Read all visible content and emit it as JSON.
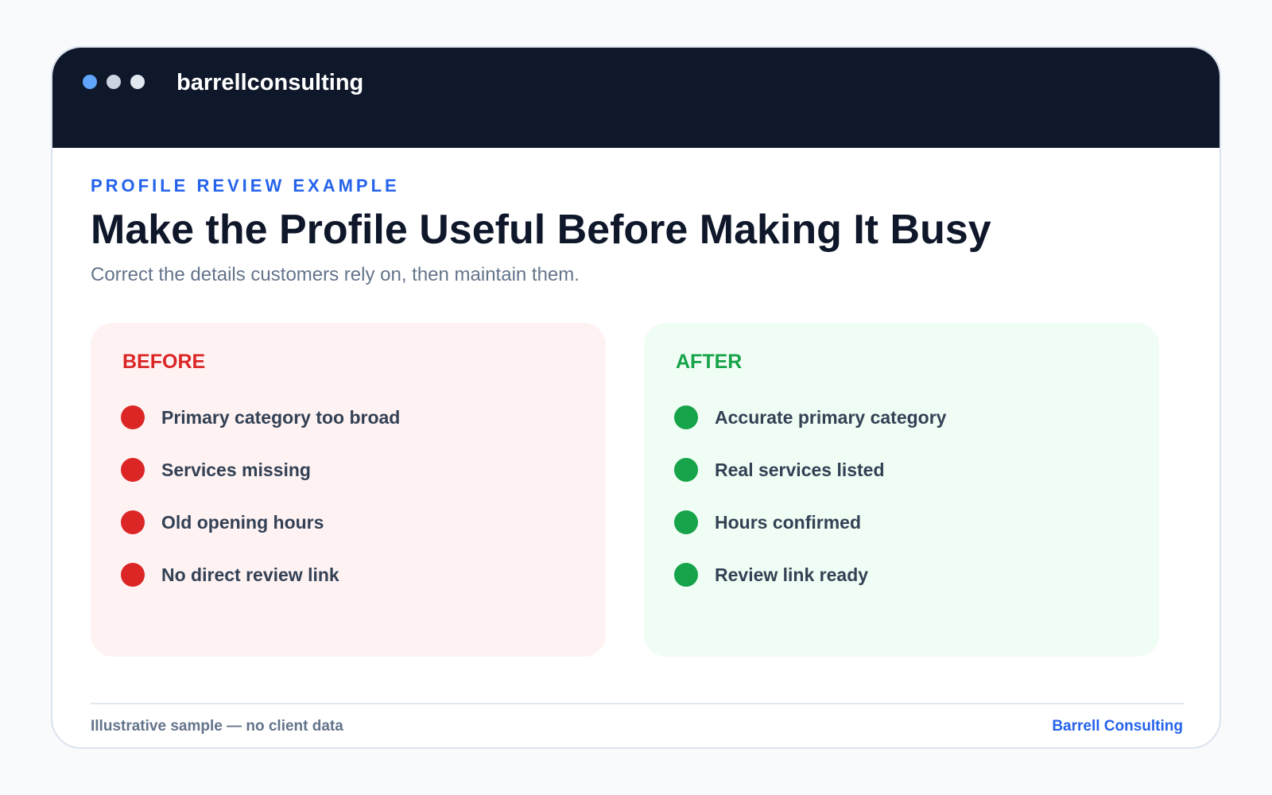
{
  "window": {
    "title": "barrellconsulting",
    "dot_colors": [
      "#60a5fa",
      "#cbd5e1",
      "#e2e8f0"
    ]
  },
  "header": {
    "eyebrow": "PROFILE REVIEW EXAMPLE",
    "title": "Make the Profile Useful Before Making It Busy",
    "subtitle": "Correct the details customers rely on, then maintain them."
  },
  "before": {
    "heading": "BEFORE",
    "color": "#dc2626",
    "items": [
      "Primary category too broad",
      "Services missing",
      "Old opening hours",
      "No direct review link"
    ]
  },
  "after": {
    "heading": "AFTER",
    "color": "#16a34a",
    "items": [
      "Accurate primary category",
      "Real services listed",
      "Hours confirmed",
      "Review link ready"
    ]
  },
  "footer": {
    "note": "Illustrative sample — no client data",
    "brand": "Barrell Consulting"
  },
  "colors": {
    "accent": "#2563eb",
    "title_bar": "#0f172a"
  }
}
